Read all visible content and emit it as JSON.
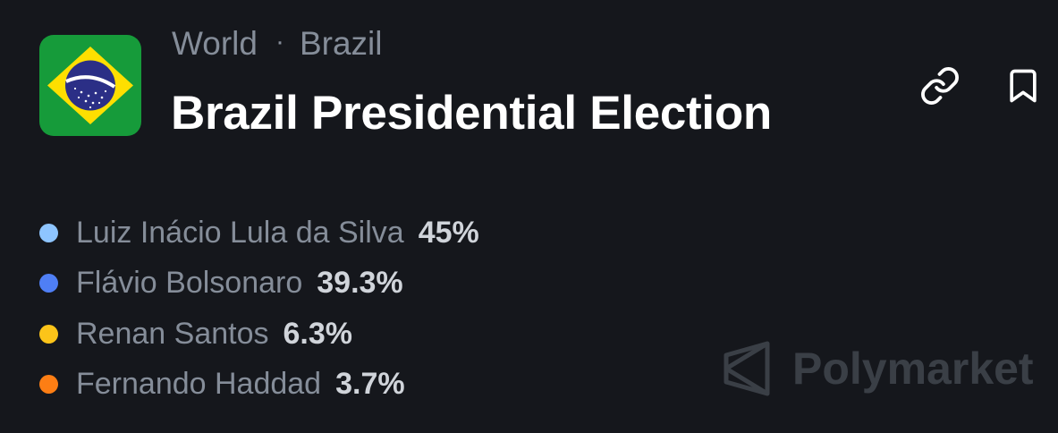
{
  "header": {
    "breadcrumb": [
      "World",
      "Brazil"
    ],
    "breadcrumb_separator": "·",
    "title": "Brazil Presidential Election",
    "flag_icon": "brazil-flag-icon",
    "actions": {
      "link_icon": "link-icon",
      "bookmark_icon": "bookmark-icon"
    }
  },
  "outcomes": [
    {
      "name": "Luiz Inácio Lula da Silva",
      "percent": "45%",
      "color": "#8ec5ff"
    },
    {
      "name": "Flávio Bolsonaro",
      "percent": "39.3%",
      "color": "#4f7ff5"
    },
    {
      "name": "Renan Santos",
      "percent": "6.3%",
      "color": "#fcc419"
    },
    {
      "name": "Fernando Haddad",
      "percent": "3.7%",
      "color": "#fd7e14"
    }
  ],
  "watermark": {
    "text": "Polymarket",
    "logo_icon": "polymarket-logo-icon"
  },
  "colors": {
    "background": "#15171c",
    "title": "#ffffff",
    "muted_text": "#858d99",
    "flag_green": "#169b3a",
    "flag_yellow": "#fedf00",
    "flag_blue": "#2b2f86"
  }
}
